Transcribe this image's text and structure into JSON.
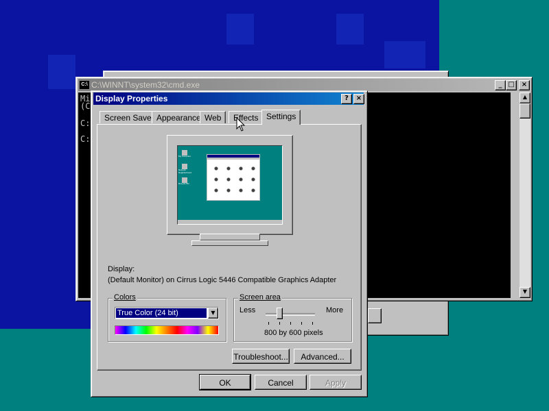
{
  "cmd_window": {
    "icon": "C:\\",
    "title": "C:\\WINNT\\system32\\cmd.exe",
    "lines": [
      "Mi",
      "(C",
      "",
      "C:",
      "",
      "C:"
    ]
  },
  "dialog": {
    "title": "Display Properties",
    "help_button": "?",
    "close_button": "×",
    "tabs": [
      "Screen Saver",
      "Appearance",
      "Web",
      "Effects",
      "Settings"
    ],
    "selected_tab": "Settings",
    "display_label": "Display:",
    "display_value": "(Default Monitor) on Cirrus Logic 5446 Compatible Graphics Adapter",
    "colors": {
      "legend": "Colors",
      "selected": "True Color (24 bit)"
    },
    "screen_area": {
      "legend": "Screen area",
      "less": "Less",
      "more": "More",
      "value_text": "800 by 600 pixels",
      "slider_position": 0.25
    },
    "buttons": {
      "troubleshoot": "Troubleshoot...",
      "advanced": "Advanced...",
      "ok": "OK",
      "cancel": "Cancel",
      "apply": "Apply"
    }
  },
  "monitor_preview": {
    "desktop_icons": [
      "My Computer",
      "Network Neighborhood",
      "Recycle Bin"
    ]
  },
  "colors": {
    "desktop": "#00807f",
    "titlebar_active": "#000080",
    "titlebar_inactive": "#808080",
    "selection": "#000080"
  }
}
